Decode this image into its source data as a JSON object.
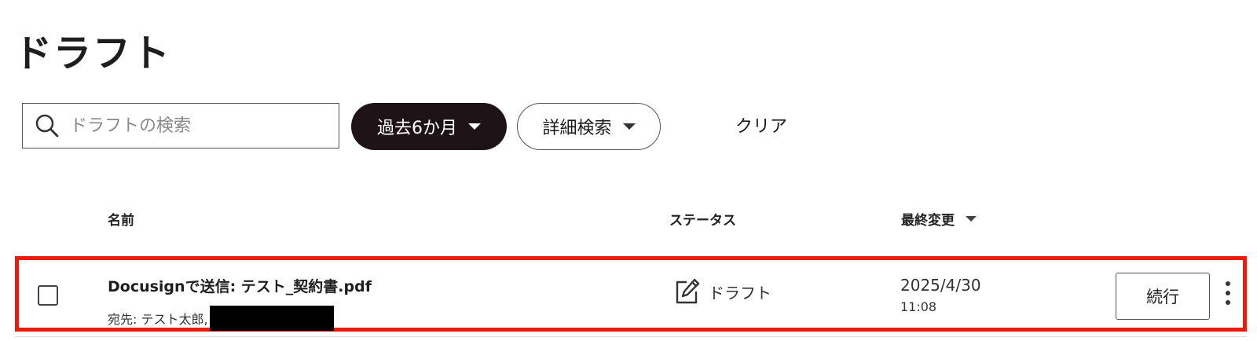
{
  "page": {
    "title": "ドラフト"
  },
  "toolbar": {
    "search_placeholder": "ドラフトの検索",
    "date_filter_label": "過去6か月",
    "advanced_search_label": "詳細検索",
    "clear_label": "クリア"
  },
  "table": {
    "columns": {
      "name": "名前",
      "status": "ステータス",
      "last_modified": "最終変更"
    },
    "rows": [
      {
        "name": "Docusignで送信: テスト_契約書.pdf",
        "recipient": "宛先: テスト太郎,",
        "status": "ドラフト",
        "date": "2025/4/30",
        "time": "11:08",
        "action_label": "続行"
      }
    ]
  },
  "colors": {
    "highlight": "#ec1c0d",
    "dark_pill": "#1e1418"
  },
  "icons": {
    "search": "search-icon",
    "status": "edit-document-icon",
    "sort": "caret-down-icon",
    "more": "more-vertical-icon"
  }
}
